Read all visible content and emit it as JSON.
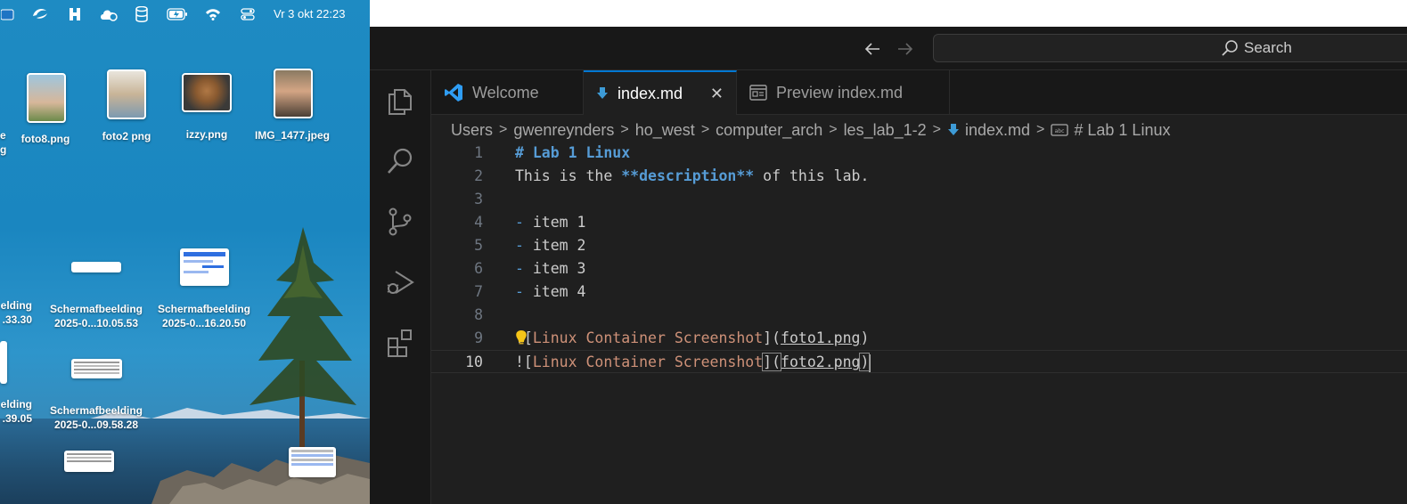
{
  "menubar": {
    "clock": "Vr 3 okt  22:23",
    "icons": [
      "finder-icon",
      "copilot-icon",
      "hotspot-h-icon",
      "cloud-sync-icon",
      "database-icon",
      "battery-icon",
      "wifi-icon",
      "control-center-icon"
    ]
  },
  "desktop": {
    "icons": [
      {
        "label": "foto8.png"
      },
      {
        "label": "foto2 png"
      },
      {
        "label": "izzy.png"
      },
      {
        "label": "IMG_1477.jpeg"
      },
      {
        "label": "e"
      },
      {
        "label": "g"
      },
      {
        "label1": "Schermafbeelding",
        "label2": "2025-0...10.05.53"
      },
      {
        "label1": "Schermafbeelding",
        "label2": "2025-0...16.20.50"
      },
      {
        "label1": "elding",
        "label2": ".33.30"
      },
      {
        "label1": "Schermafbeelding",
        "label2": "2025-0...09.58.28"
      },
      {
        "label1": "elding",
        "label2": ".39.05"
      }
    ]
  },
  "titlebar": {
    "search_label": "Search"
  },
  "activity": [
    "explorer-icon",
    "search-icon",
    "source-control-icon",
    "run-debug-icon",
    "extensions-icon"
  ],
  "tabs": [
    {
      "label": "Welcome",
      "active": false
    },
    {
      "label": "index.md",
      "active": true
    },
    {
      "label": "Preview index.md",
      "active": false
    }
  ],
  "breadcrumb": [
    "Users",
    "gwenreynders",
    "ho_west",
    "computer_arch",
    "les_lab_1-2",
    "index.md",
    "# Lab 1 Linux"
  ],
  "editor": {
    "current_line": 10,
    "lines": [
      {
        "n": "1",
        "text": "# Lab 1 Linux"
      },
      {
        "n": "2",
        "pre": "This is the ",
        "bold": "**description**",
        "post": " of this lab."
      },
      {
        "n": "3",
        "text": ""
      },
      {
        "n": "4",
        "dash": "-",
        "text": " item 1"
      },
      {
        "n": "5",
        "dash": "-",
        "text": " item 2"
      },
      {
        "n": "6",
        "dash": "-",
        "text": " item 3"
      },
      {
        "n": "7",
        "dash": "-",
        "text": " item 4"
      },
      {
        "n": "8",
        "text": ""
      },
      {
        "n": "9",
        "bang": "!",
        "lbr": "[",
        "link": "Linux Container Screenshot",
        "rbr": "](",
        "url": "foto1.png",
        "close": ")"
      },
      {
        "n": "10",
        "bang": "![",
        "link": "Linux Container Screenshot",
        "rbr": "](",
        "url": "foto2.png",
        "close": ")"
      }
    ]
  }
}
